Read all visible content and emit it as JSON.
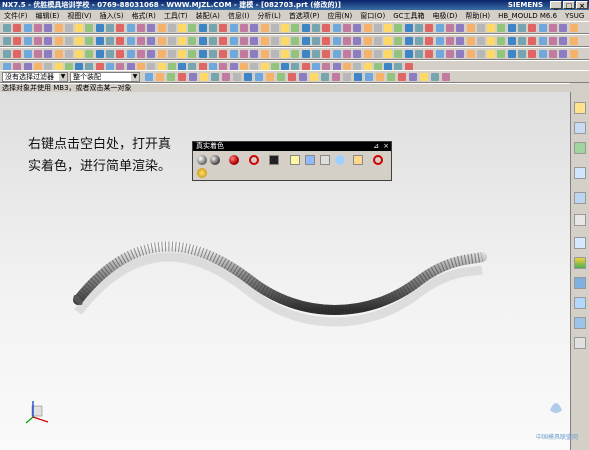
{
  "window": {
    "title": "NX7.5 - 优胜模具培训学校 - 0769-88031068 - WWW.MJZL.COM - 建模 - [082703.prt (修改的)]",
    "brand": "SIEMENS",
    "buttons": [
      "_",
      "□",
      "×"
    ]
  },
  "menubar": {
    "items": [
      "文件(F)",
      "编辑(E)",
      "视图(V)",
      "插入(S)",
      "格式(R)",
      "工具(T)",
      "装配(A)",
      "信息(I)",
      "分析(L)",
      "首选项(P)",
      "应用(N)",
      "窗口(O)",
      "GC工具箱",
      "电极(D)",
      "帮助(H)",
      "HB_MOULD M6.6",
      "YSUG"
    ]
  },
  "selection_bar": {
    "filter_value": "没有选择过滤器",
    "scope_value": "整个装配"
  },
  "status": {
    "prompt": "选择对象并使用 MB3，或者双击某一对象"
  },
  "instruction": {
    "line1": "右键点击空白处，打开真",
    "line2": "实着色，进行简单渲染。"
  },
  "render_panel": {
    "title": "真实着色",
    "pin": "⊿",
    "close": "×"
  },
  "watermark": {
    "text": "中国模具联盟网"
  },
  "colors": {
    "titlebar": "#0a246a",
    "ui_grey": "#d4d0c8",
    "viewport_top": "#dedede",
    "viewport_bottom": "#fafafa"
  }
}
